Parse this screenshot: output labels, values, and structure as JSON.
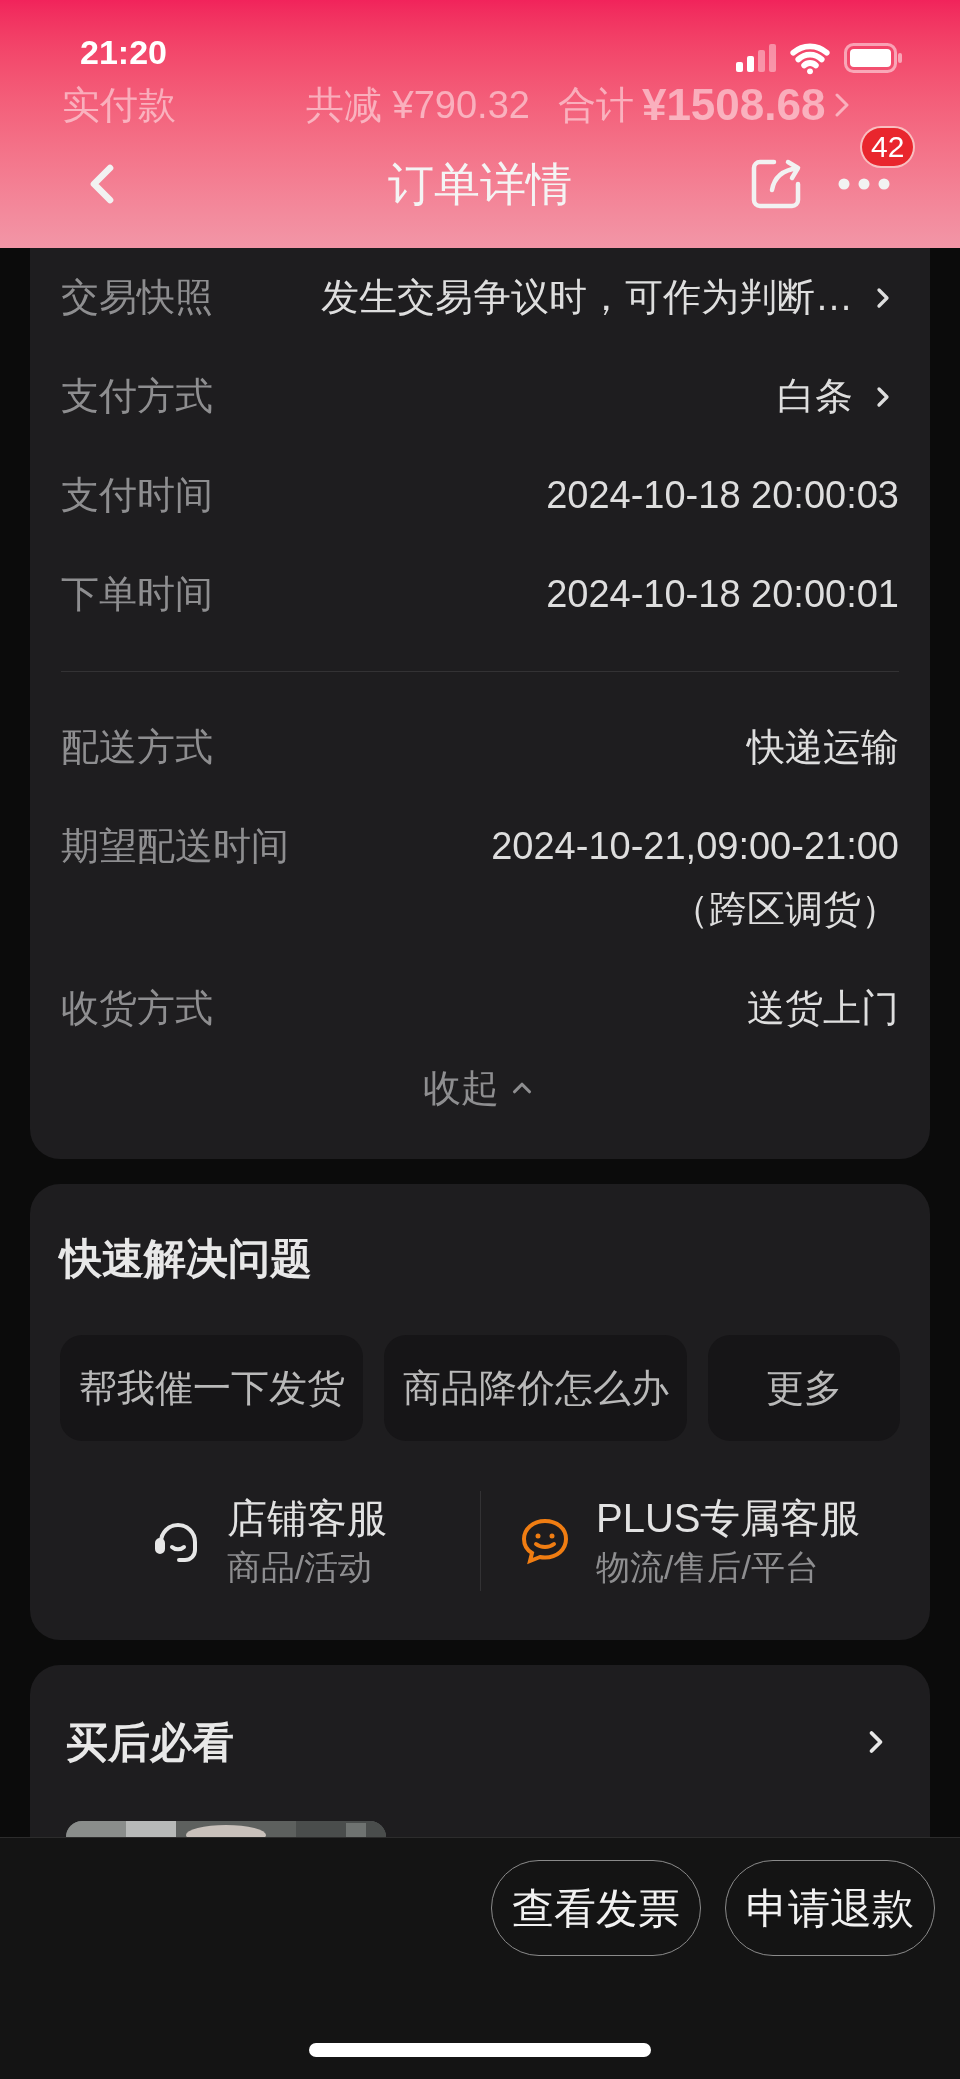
{
  "status_bar": {
    "time": "21:20"
  },
  "underlay": {
    "paid_label": "实付款",
    "discount": "共减 ¥790.32",
    "total_label": "合计",
    "total": "¥1508.68"
  },
  "nav": {
    "title": "订单详情",
    "badge": "42"
  },
  "order_info": {
    "groups": [
      [
        {
          "label": "交易快照",
          "value": "发生交易争议时，可作为判断…",
          "link": true
        },
        {
          "label": "支付方式",
          "value": "白条",
          "link": true
        },
        {
          "label": "支付时间",
          "value": "2024-10-18 20:00:03",
          "link": false
        },
        {
          "label": "下单时间",
          "value": "2024-10-18 20:00:01",
          "link": false
        }
      ],
      [
        {
          "label": "配送方式",
          "value": "快递运输",
          "link": false
        },
        {
          "label": "期望配送时间",
          "value": [
            "2024-10-21,09:00-21:00",
            "（跨区调货）"
          ],
          "link": false
        },
        {
          "label": "收货方式",
          "value": "送货上门",
          "link": false
        }
      ]
    ],
    "collapse": "收起"
  },
  "quick_help": {
    "title": "快速解决问题",
    "actions": [
      "帮我催一下发货",
      "商品降价怎么办",
      "更多"
    ],
    "services": [
      {
        "kind": "headset",
        "name": "店铺客服",
        "sub": "商品/活动"
      },
      {
        "kind": "smile",
        "name": "PLUS专属客服",
        "sub": "物流/售后/平台"
      }
    ]
  },
  "after_sale": {
    "title": "买后必看"
  },
  "bottom_actions": [
    "查看发票",
    "申请退款"
  ]
}
